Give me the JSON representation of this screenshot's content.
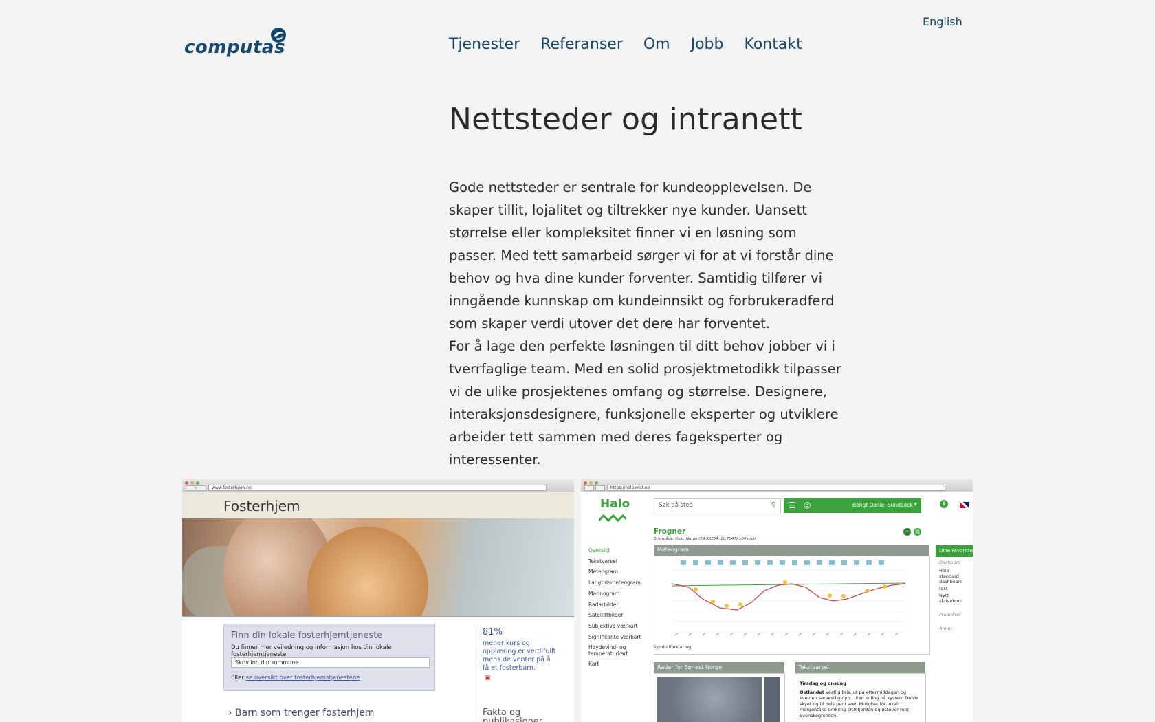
{
  "header": {
    "logo_text": "computas",
    "language_link": "English",
    "nav": [
      "Tjenester",
      "Referanser",
      "Om",
      "Jobb",
      "Kontakt"
    ]
  },
  "main": {
    "title": "Nettsteder og intranett",
    "paragraphs": [
      "Gode nettsteder er sentrale for kundeopplevelsen. De skaper tillit, lojalitet og tiltrekker nye kunder. Uansett størrelse eller kompleksitet finner vi en løsning som passer. Med tett samarbeid sørger vi for at vi forstår dine behov og hva dine kunder forventer. Samtidig tilfører vi inngående kunnskap om kundeinnsikt og forbrukeradferd som skaper verdi utover det dere har forventet.",
      "For å lage den perfekte løsningen til ditt behov jobber vi i tverrfaglige team. Med en solid prosjektmetodikk tilpasser vi de ulike prosjektenes omfang og størrelse. Designere, interaksjonsdesignere, funksjonelle eksperter og utviklere arbeider tett sammen med deres fageksperter og interessenter."
    ]
  },
  "fosterhjem": {
    "url": "www.fosterhjem.no",
    "site_title": "Fosterhjem",
    "box_title": "Finn din lokale fosterhjemtjeneste",
    "box_sub": "Du finner mer veiledning og informasjon hos din lokale fosterhjemtjeneste",
    "input_placeholder": "Skriv inn din kommune",
    "link_prefix": "Eller ",
    "link_text": "se oversikt over fosterhjemstjenestene",
    "stat_value": "81%",
    "stat_text": "mener kurs og opplæring er verdifullt mens de venter på å få et fosterbarn.",
    "bottom_left": "› Barn som trenger fosterhjem",
    "bottom_right": "Fakta og publikasjoner"
  },
  "halo": {
    "url": "https://halo.met.no",
    "logo": "Halo",
    "search_placeholder": "Søk på sted",
    "user": "Bengt Daniel Sundbäck",
    "place": "Frogner",
    "coords": "Bysmråde, Oslo, Norge (59.92264, 10.7047) 104 moh",
    "sidenav": [
      "Oversikt",
      "Tekstvarsel",
      "Meteogram",
      "Langtidsmeteogram",
      "Marinogram",
      "Radarbilder",
      "Satellittbilder",
      "Subjektive værkart",
      "Signifikante værkart",
      "Høydevind- og temperaturkart",
      "Kart"
    ],
    "meteogram_title": "Meteogram",
    "symbol_label": "Symbolforklaring",
    "fav_title": "Dine Favoritter",
    "fav_items": [
      "Dashbord",
      "Halo standard dashboard",
      "test",
      "Nytt skrivebord",
      "Produkter",
      "Annet"
    ],
    "radar_title": "Radar for Sør-øst Norge",
    "text_title": "Tekstvarsel",
    "text_day": "Tirsdag og onsdag",
    "text_region": "Østlandet",
    "text_body": "Vestlig bris, ut på ettermiddagen og kvelden sørvestlig opp i liten kuling på kysten. Delvis skyet og til dels pent vær. Mulighet for lokal morgentåke omkring Oslofjorden og østover mot Svenskegrensen.",
    "colors": {
      "green": "#3ba33b",
      "grey_panel": "#8d9a8d"
    }
  },
  "colors": {
    "brand_blue": "#154a6e",
    "background": "#f3f3f3"
  }
}
